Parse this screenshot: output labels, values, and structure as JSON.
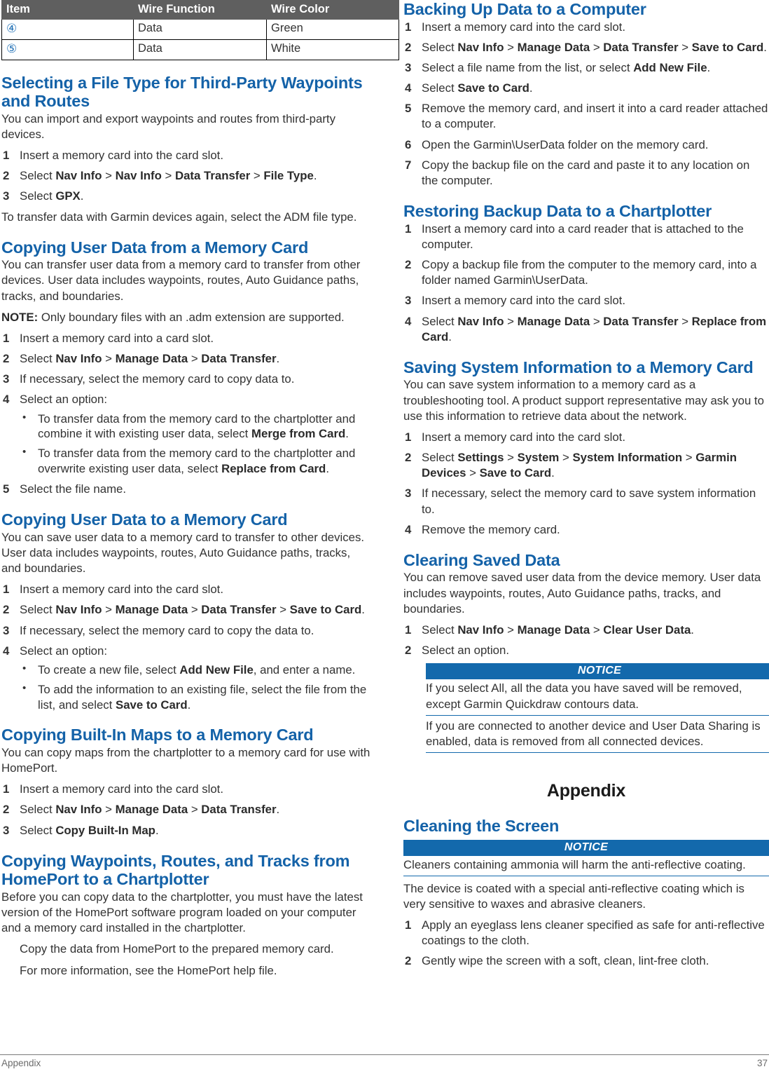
{
  "table": {
    "headers": [
      "Item",
      "Wire Function",
      "Wire Color"
    ],
    "rows": [
      {
        "item": "④",
        "function": "Data",
        "color": "Green"
      },
      {
        "item": "⑤",
        "function": "Data",
        "color": "White"
      }
    ]
  },
  "left": {
    "s1": {
      "heading": "Selecting a File Type for Third-Party Waypoints and Routes",
      "intro": "You can import and export waypoints and routes from third-party devices.",
      "steps": [
        {
          "n": "1",
          "html": "Insert a memory card into the card slot."
        },
        {
          "n": "2",
          "html": "Select <b>Nav Info</b> > <b>Nav Info</b> > <b>Data Transfer</b> > <b>File Type</b>."
        },
        {
          "n": "3",
          "html": "Select <b>GPX</b>."
        }
      ],
      "outro": "To transfer data with Garmin devices again, select the ADM file type."
    },
    "s2": {
      "heading": "Copying User Data from a Memory Card",
      "intro": "You can transfer user data from a memory card to transfer from other devices. User data includes waypoints, routes, Auto Guidance paths, tracks, and boundaries.",
      "note": "<b>NOTE:</b> Only boundary files with an .adm extension are supported.",
      "steps": [
        {
          "n": "1",
          "html": "Insert a memory card into a card slot."
        },
        {
          "n": "2",
          "html": "Select <b>Nav Info</b> > <b>Manage Data</b> > <b>Data Transfer</b>."
        },
        {
          "n": "3",
          "html": "If necessary, select the memory card to copy data to."
        },
        {
          "n": "4",
          "html": "Select an option:",
          "subs": [
            "To transfer data from the memory card to the chartplotter and combine it with existing user data, select <b>Merge from Card</b>.",
            "To transfer data from the memory card to the chartplotter and overwrite existing user data, select <b>Replace from Card</b>."
          ]
        },
        {
          "n": "5",
          "html": "Select the file name."
        }
      ]
    },
    "s3": {
      "heading": "Copying User Data to a Memory Card",
      "intro": "You can save user data to a memory card to transfer to other devices. User data includes waypoints, routes, Auto Guidance paths, tracks, and boundaries.",
      "steps": [
        {
          "n": "1",
          "html": "Insert a memory card into the card slot."
        },
        {
          "n": "2",
          "html": "Select <b>Nav Info</b> > <b>Manage Data</b> > <b>Data Transfer</b> > <b>Save to Card</b>."
        },
        {
          "n": "3",
          "html": "If necessary, select the memory card to copy the data to."
        },
        {
          "n": "4",
          "html": "Select an option:",
          "subs": [
            "To create a new file, select <b>Add New File</b>, and enter a name.",
            "To add the information to an existing file, select the file from the list, and select <b>Save to Card</b>."
          ]
        }
      ]
    },
    "s4": {
      "heading": "Copying Built-In Maps to a Memory Card",
      "intro": "You can copy maps from the chartplotter to a memory card for use with HomePort.",
      "steps": [
        {
          "n": "1",
          "html": "Insert a memory card into the card slot."
        },
        {
          "n": "2",
          "html": "Select <b>Nav Info</b> > <b>Manage Data</b> > <b>Data Transfer</b>."
        },
        {
          "n": "3",
          "html": "Select <b>Copy Built-In Map</b>."
        }
      ]
    },
    "s5": {
      "heading": "Copying Waypoints, Routes, and Tracks from HomePort to a Chartplotter",
      "intro": "Before you can copy data to the chartplotter, you must have the latest version of the HomePort software program loaded on your computer and a memory card installed in the chartplotter.",
      "plain1": "Copy the data from HomePort to the prepared memory card.",
      "plain2": "For more information, see the HomePort help file."
    }
  },
  "right": {
    "s1": {
      "heading": "Backing Up Data to a Computer",
      "steps": [
        {
          "n": "1",
          "html": "Insert a memory card into the card slot."
        },
        {
          "n": "2",
          "html": "Select <b>Nav Info</b> > <b>Manage Data</b> > <b>Data Transfer</b> > <b>Save to Card</b>."
        },
        {
          "n": "3",
          "html": "Select a file name from the list, or select <b>Add New File</b>."
        },
        {
          "n": "4",
          "html": "Select <b>Save to Card</b>."
        },
        {
          "n": "5",
          "html": "Remove the memory card, and insert it into a card reader attached to a computer."
        },
        {
          "n": "6",
          "html": "Open the Garmin\\UserData folder on the memory card."
        },
        {
          "n": "7",
          "html": "Copy the backup file on the card and paste it to any location on the computer."
        }
      ]
    },
    "s2": {
      "heading": "Restoring Backup Data to a Chartplotter",
      "steps": [
        {
          "n": "1",
          "html": "Insert a memory card into a card reader that is attached to the computer."
        },
        {
          "n": "2",
          "html": "Copy a backup file from the computer to the memory card, into a folder named Garmin\\UserData."
        },
        {
          "n": "3",
          "html": "Insert a memory card into the card slot."
        },
        {
          "n": "4",
          "html": "Select <b>Nav Info</b> > <b>Manage Data</b> > <b>Data Transfer</b> > <b>Replace from Card</b>."
        }
      ]
    },
    "s3": {
      "heading": "Saving System Information to a Memory Card",
      "intro": "You can save system information to a memory card as a troubleshooting tool. A product support representative may ask you to use this information to retrieve data about the network.",
      "steps": [
        {
          "n": "1",
          "html": "Insert a memory card into the card slot."
        },
        {
          "n": "2",
          "html": "Select <b>Settings</b> > <b>System</b> > <b>System Information</b> > <b>Garmin Devices</b> > <b>Save to Card</b>."
        },
        {
          "n": "3",
          "html": "If necessary, select the memory card to save system information to."
        },
        {
          "n": "4",
          "html": "Remove the memory card."
        }
      ]
    },
    "s4": {
      "heading": "Clearing Saved Data",
      "intro": "You can remove saved user data from the device memory. User data includes waypoints, routes, Auto Guidance paths, tracks, and boundaries.",
      "steps": [
        {
          "n": "1",
          "html": "Select <b>Nav Info</b> > <b>Manage Data</b> > <b>Clear User Data</b>."
        },
        {
          "n": "2",
          "html": "Select an option."
        }
      ],
      "notice": {
        "label": "NOTICE",
        "paragraphs": [
          "If you select All, all the data you have saved will be removed, except Garmin Quickdraw contours data.",
          "If you are connected to another device and User Data Sharing is enabled, data is removed from all connected devices."
        ]
      }
    },
    "appendix_title": "Appendix",
    "s5": {
      "heading": "Cleaning the Screen",
      "notice": {
        "label": "NOTICE",
        "paragraphs": [
          "Cleaners containing ammonia will harm the anti-reflective coating."
        ]
      },
      "intro": "The device is coated with a special anti-reflective coating which is very sensitive to waxes and abrasive cleaners.",
      "steps": [
        {
          "n": "1",
          "html": "Apply an eyeglass lens cleaner specified as safe for anti-reflective coatings to the cloth."
        },
        {
          "n": "2",
          "html": "Gently wipe the screen with a soft, clean, lint-free cloth."
        }
      ]
    }
  },
  "footer": {
    "left": "Appendix",
    "right": "37"
  },
  "colors": {
    "heading_blue": "#1462a8",
    "notice_blue": "#1369ac",
    "table_header_gray": "#5f5f5f",
    "body_text": "#333333"
  }
}
